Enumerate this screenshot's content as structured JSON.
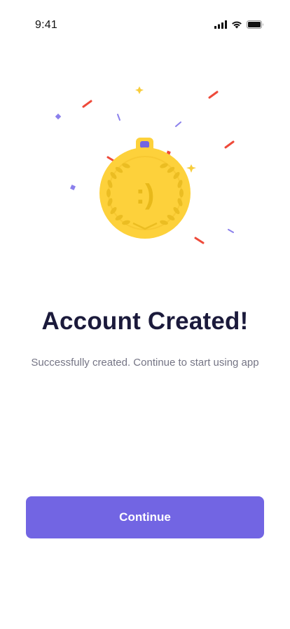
{
  "status_bar": {
    "time": "9:41",
    "icons": [
      "cellular-signal-icon",
      "wifi-icon",
      "battery-icon"
    ]
  },
  "illustration": {
    "subject": "medal-icon",
    "face_text": ":)",
    "colors": {
      "medal": "#fdd13b",
      "medal_accent": "#e8b91a",
      "ribbon_clip": "#7265e3",
      "confetti_red": "#ee4a3a",
      "confetti_purple": "#8b80ec",
      "star": "#f8cd3c"
    }
  },
  "main": {
    "title": "Account Created!",
    "subtitle": "Successfully created. Continue to start using app"
  },
  "actions": {
    "continue_label": "Continue"
  },
  "colors": {
    "accent": "#7265e3",
    "title": "#1b1a3b",
    "body_text": "#757585",
    "background": "#ffffff"
  }
}
